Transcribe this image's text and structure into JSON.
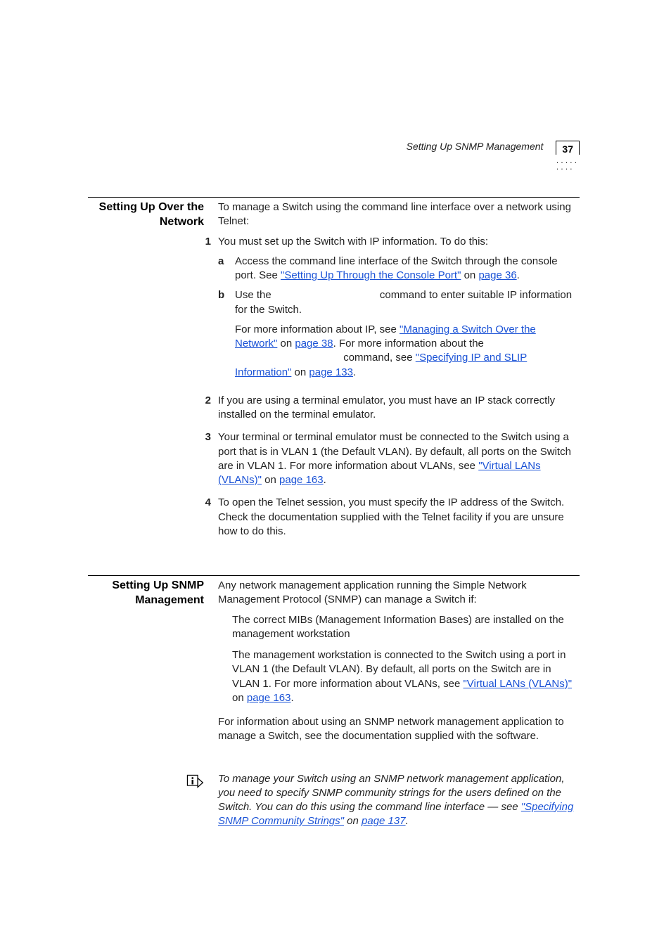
{
  "header": {
    "title": "Setting Up SNMP Management",
    "page_number": "37"
  },
  "section1": {
    "label": "Setting Up Over the Network",
    "intro": "To manage a Switch using the command line interface over a network using Telnet:",
    "items": [
      {
        "num": "1",
        "text": "You must set up the Switch with IP information. To do this:",
        "alpha": [
          {
            "m": "a",
            "pre": "Access the command line interface of the Switch through the console port. See ",
            "link1": "\"Setting Up Through the Console Port\"",
            "mid": " on ",
            "link2": "page 36",
            "post": "."
          },
          {
            "m": "b",
            "pre": "Use the ",
            "gap": "                                    ",
            "text1": "command to enter suitable IP information for the Switch.",
            "extra_pre": "For more information about IP, see ",
            "extra_link1": "\"Managing a Switch Over the Network\"",
            "extra_mid1": " on ",
            "extra_link2": "page 38",
            "extra_mid2": ". For more information about the ",
            "extra_gap": "                                    ",
            "extra_text2": " command, see ",
            "extra_link3": "\"Specifying IP and SLIP Information\"",
            "extra_mid3": " on ",
            "extra_link4": "page 133",
            "extra_post": "."
          }
        ]
      },
      {
        "num": "2",
        "text": "If you are using a terminal emulator, you must have an IP stack correctly installed on the terminal emulator."
      },
      {
        "num": "3",
        "pre": "Your terminal or terminal emulator must be connected to the Switch using a port that is in VLAN 1 (the Default VLAN). By default, all ports on the Switch are in VLAN 1. For more information about VLANs, see ",
        "link1": "\"Virtual LANs (VLANs)\"",
        "mid": " on ",
        "link2": "page 163",
        "post": "."
      },
      {
        "num": "4",
        "text": "To open the Telnet session, you must specify the IP address of the Switch. Check the documentation supplied with the Telnet facility if you are unsure how to do this."
      }
    ]
  },
  "section2": {
    "label": "Setting Up SNMP Management",
    "intro": "Any network management application running the Simple Network Management Protocol (SNMP) can manage a Switch if:",
    "bullets": [
      {
        "text": "The correct MIBs (Management Information Bases) are installed on the management workstation"
      },
      {
        "pre": "The management workstation is connected to the Switch using a port in VLAN 1 (the Default VLAN). By default, all ports on the Switch are in VLAN 1. For more information about VLANs, see ",
        "link1": "\"Virtual LANs (VLANs)\"",
        "mid": " on ",
        "link2": "page 163",
        "post": "."
      }
    ],
    "info": "For information about using an SNMP network management application to manage a Switch, see the documentation supplied with the software.",
    "note": {
      "pre": "To manage your Switch using an SNMP network management application, you need to specify SNMP community strings for the users defined on the Switch. You can do this using the command line interface — see ",
      "link1": "\"Specifying SNMP Community Strings\"",
      "mid": " on ",
      "link2": "page 137",
      "post": "."
    }
  }
}
